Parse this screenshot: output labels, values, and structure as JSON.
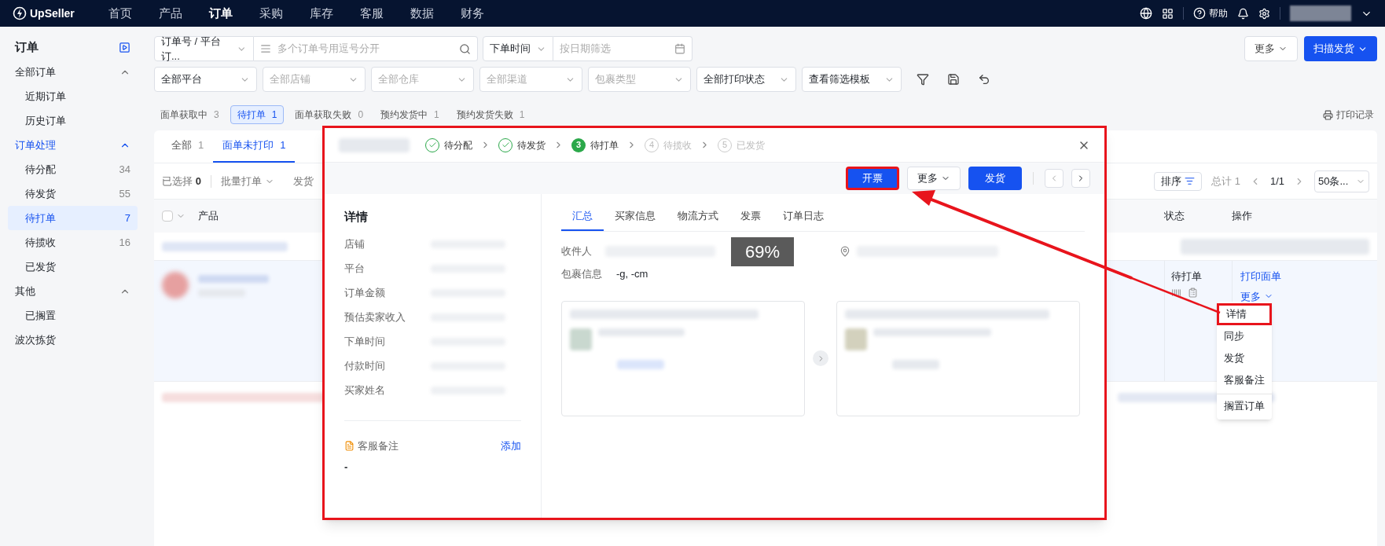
{
  "top_nav": {
    "logo": "UpSeller",
    "help": "帮助",
    "items": [
      {
        "label": "首页",
        "selected": false
      },
      {
        "label": "产品",
        "selected": false
      },
      {
        "label": "订单",
        "selected": true
      },
      {
        "label": "采购",
        "selected": false
      },
      {
        "label": "库存",
        "selected": false
      },
      {
        "label": "客服",
        "selected": false
      },
      {
        "label": "数据",
        "selected": false
      },
      {
        "label": "财务",
        "selected": false
      }
    ]
  },
  "sidebar": {
    "title": "订单",
    "groups": [
      {
        "label": "全部订单",
        "active": false,
        "expanded": true,
        "children": [
          {
            "label": "近期订单",
            "selected": false
          },
          {
            "label": "历史订单",
            "selected": false
          }
        ]
      },
      {
        "label": "订单处理",
        "active": true,
        "expanded": true,
        "children": [
          {
            "label": "待分配",
            "count": "34",
            "selected": false
          },
          {
            "label": "待发货",
            "count": "55",
            "selected": false
          },
          {
            "label": "待打单",
            "count": "7",
            "selected": true
          },
          {
            "label": "待揽收",
            "count": "16",
            "selected": false
          },
          {
            "label": "已发货",
            "selected": false
          }
        ]
      },
      {
        "label": "其他",
        "active": false,
        "expanded": true,
        "children": [
          {
            "label": "已搁置",
            "selected": false
          }
        ]
      },
      {
        "label": "波次拣货",
        "active": false
      }
    ]
  },
  "filters": {
    "search_type": "订单号 / 平台订...",
    "search_placeholder": "多个订单号用逗号分开",
    "date_type": "下单时间",
    "date_placeholder": "按日期筛选",
    "more_button": "更多",
    "scan_button": "扫描发货",
    "selects": [
      {
        "text": "全部平台",
        "kind": "value"
      },
      {
        "text": "全部店铺",
        "kind": "placeholder"
      },
      {
        "text": "全部仓库",
        "kind": "placeholder"
      },
      {
        "text": "全部渠道",
        "kind": "placeholder"
      },
      {
        "text": "包裹类型",
        "kind": "placeholder"
      },
      {
        "text": "全部打印状态",
        "kind": "value"
      },
      {
        "text": "查看筛选模板",
        "kind": "value"
      }
    ]
  },
  "status_tabs": [
    {
      "label": "面单获取中",
      "count": "3",
      "selected": false
    },
    {
      "label": "待打单",
      "count": "1",
      "selected": true
    },
    {
      "label": "面单获取失败",
      "count": "0",
      "selected": false
    },
    {
      "label": "预约发货中",
      "count": "1",
      "selected": false
    },
    {
      "label": "预约发货失败",
      "count": "1",
      "selected": false
    }
  ],
  "print_log": "打印记录",
  "card": {
    "tabs": [
      {
        "label": "全部",
        "count": "1",
        "selected": false
      },
      {
        "label": "面单未打印",
        "count": "1",
        "selected": true
      }
    ],
    "toolbar": {
      "selected_label": "已选择",
      "selected_count": "0",
      "batch_print": "批量打单",
      "ship": "发货",
      "sort": "排序",
      "total": "总计 1",
      "page": "1/1",
      "page_size": "50条..."
    },
    "table": {
      "columns": [
        "产品",
        "状态",
        "操作"
      ],
      "select_all_checked": false,
      "status": "待打单",
      "print_link": "打印面单",
      "more": "更多",
      "menu": [
        {
          "label": "详情",
          "highlighted": true,
          "separated": false
        },
        {
          "label": "同步",
          "highlighted": false,
          "separated": false
        },
        {
          "label": "发货",
          "highlighted": false,
          "separated": false
        },
        {
          "label": "客服备注",
          "highlighted": false,
          "separated": false
        },
        {
          "label": "搁置订单",
          "highlighted": false,
          "separated": true
        }
      ]
    }
  },
  "modal": {
    "steps": [
      {
        "label": "待分配",
        "kind": "done"
      },
      {
        "label": "待发货",
        "kind": "done"
      },
      {
        "number": "3",
        "label": "待打单",
        "kind": "current"
      },
      {
        "number": "4",
        "label": "待揽收",
        "kind": "pending"
      },
      {
        "number": "5",
        "label": "已发货",
        "kind": "pending"
      }
    ],
    "invoice_button": {
      "label": "开票",
      "highlighted": true
    },
    "more_button": "更多",
    "ship_button": "发货",
    "details_title": "详情",
    "fields": [
      "店铺",
      "平台",
      "订单金额",
      "预估卖家收入",
      "下单时间",
      "付款时间",
      "买家姓名"
    ],
    "note_label": "客服备注",
    "note_add": "添加",
    "note_value": "-",
    "tabs": [
      {
        "label": "汇总",
        "selected": true
      },
      {
        "label": "买家信息",
        "selected": false
      },
      {
        "label": "物流方式",
        "selected": false
      },
      {
        "label": "发票",
        "selected": false
      },
      {
        "label": "订单日志",
        "selected": false
      }
    ],
    "recipient_label": "收件人",
    "package_label": "包裹信息",
    "package_value": "-g, -cm",
    "zoom_indicator": "69%"
  }
}
